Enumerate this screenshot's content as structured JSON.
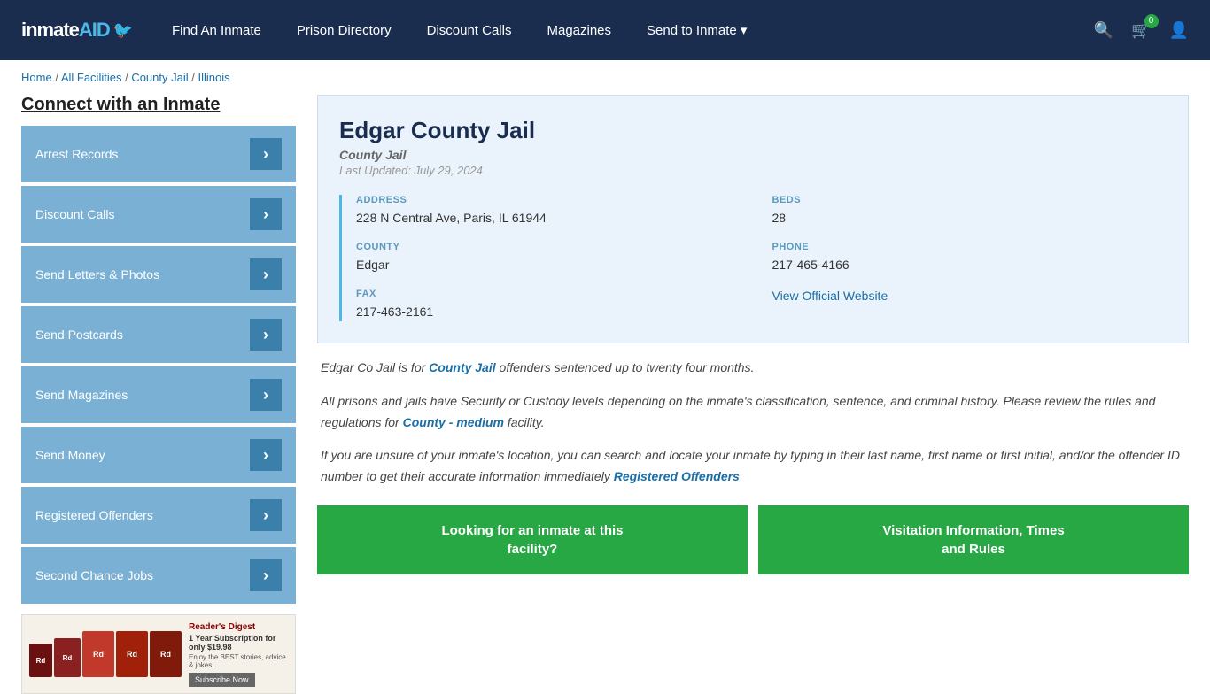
{
  "header": {
    "logo": "inmateAID",
    "nav": [
      {
        "label": "Find An Inmate",
        "id": "find-inmate"
      },
      {
        "label": "Prison Directory",
        "id": "prison-directory"
      },
      {
        "label": "Discount Calls",
        "id": "discount-calls"
      },
      {
        "label": "Magazines",
        "id": "magazines"
      },
      {
        "label": "Send to Inmate ▾",
        "id": "send-to-inmate"
      }
    ],
    "cart_count": "0"
  },
  "breadcrumb": {
    "items": [
      "Home",
      "All Facilities",
      "County Jail",
      "Illinois"
    ]
  },
  "sidebar": {
    "title": "Connect with an Inmate",
    "menu": [
      {
        "label": "Arrest Records",
        "id": "arrest-records"
      },
      {
        "label": "Discount Calls",
        "id": "discount-calls"
      },
      {
        "label": "Send Letters & Photos",
        "id": "send-letters"
      },
      {
        "label": "Send Postcards",
        "id": "send-postcards"
      },
      {
        "label": "Send Magazines",
        "id": "send-magazines"
      },
      {
        "label": "Send Money",
        "id": "send-money"
      },
      {
        "label": "Registered Offenders",
        "id": "registered-offenders"
      },
      {
        "label": "Second Chance Jobs",
        "id": "second-chance-jobs"
      }
    ],
    "ad": {
      "title": "Reader's Digest",
      "offer": "1 Year Subscription for only $19.98",
      "tagline": "Enjoy the BEST stories, advice & jokes!",
      "button": "Subscribe Now"
    }
  },
  "facility": {
    "name": "Edgar County Jail",
    "type": "County Jail",
    "last_updated": "Last Updated: July 29, 2024",
    "address_label": "ADDRESS",
    "address": "228 N Central Ave, Paris, IL 61944",
    "beds_label": "BEDS",
    "beds": "28",
    "county_label": "COUNTY",
    "county": "Edgar",
    "phone_label": "PHONE",
    "phone": "217-465-4166",
    "fax_label": "FAX",
    "fax": "217-463-2161",
    "website_label": "View Official Website",
    "website_url": "#"
  },
  "description": {
    "para1_prefix": "Edgar Co Jail is for ",
    "para1_link": "County Jail",
    "para1_suffix": " offenders sentenced up to twenty four months.",
    "para2_prefix": "All prisons and jails have Security or Custody levels depending on the inmate's classification, sentence, and criminal history. Please review the rules and regulations for ",
    "para2_link": "County - medium",
    "para2_suffix": " facility.",
    "para3_prefix": "If you are unsure of your inmate's location, you can search and locate your inmate by typing in their last name, first name or first initial, and/or the offender ID number to get their accurate information immediately ",
    "para3_link": "Registered Offenders"
  },
  "actions": {
    "button1_line1": "Looking for an inmate at this",
    "button1_line2": "facility?",
    "button2_line1": "Visitation Information, Times",
    "button2_line2": "and Rules"
  }
}
